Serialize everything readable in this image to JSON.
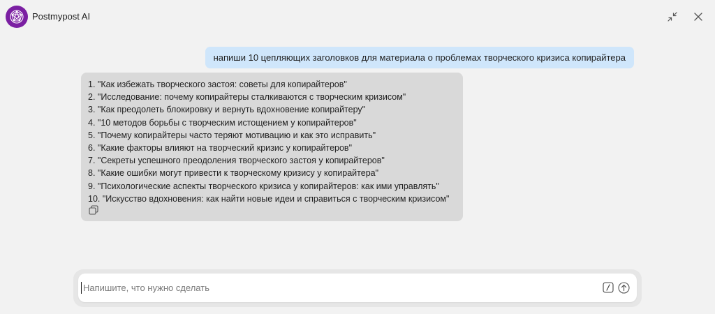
{
  "app": {
    "title": "Postmypost AI",
    "logo_color": "#7b1fa2"
  },
  "header": {
    "minimize_icon": "collapse-arrows-icon",
    "close_icon": "close-icon"
  },
  "conversation": {
    "user_message": "напиши 10 цепляющих заголовков для материала о проблемах творческого кризиса копирайтера",
    "assistant_items": [
      "1. \"Как избежать творческого застоя: советы для копирайтеров\"",
      "2. \"Исследование: почему копирайтеры сталкиваются с творческим кризисом\"",
      "3. \"Как преодолеть блокировку и вернуть вдохновение копирайтеру\"",
      "4. \"10 методов борьбы с творческим истощением у копирайтеров\"",
      "5. \"Почему копирайтеры часто теряют мотивацию и как это исправить\"",
      "6. \"Какие факторы влияют на творческий кризис у копирайтеров\"",
      "7. \"Секреты успешного преодоления творческого застоя у копирайтеров\"",
      "8. \"Какие ошибки могут привести к творческому кризису у копирайтера\"",
      "9. \"Психологические аспекты творческого кризиса у копирайтеров: как ими управлять\"",
      "10. \"Искусство вдохновения: как найти новые идеи и справиться с творческим кризисом\""
    ],
    "copy_icon": "copy-icon",
    "user_bubble_color": "#cfe6fb",
    "assistant_bubble_color": "#d9d9d9"
  },
  "composer": {
    "placeholder": "Напишите, что нужно сделать",
    "value": "",
    "slash_icon": "slash-command-icon",
    "send_icon": "send-arrow-icon"
  }
}
